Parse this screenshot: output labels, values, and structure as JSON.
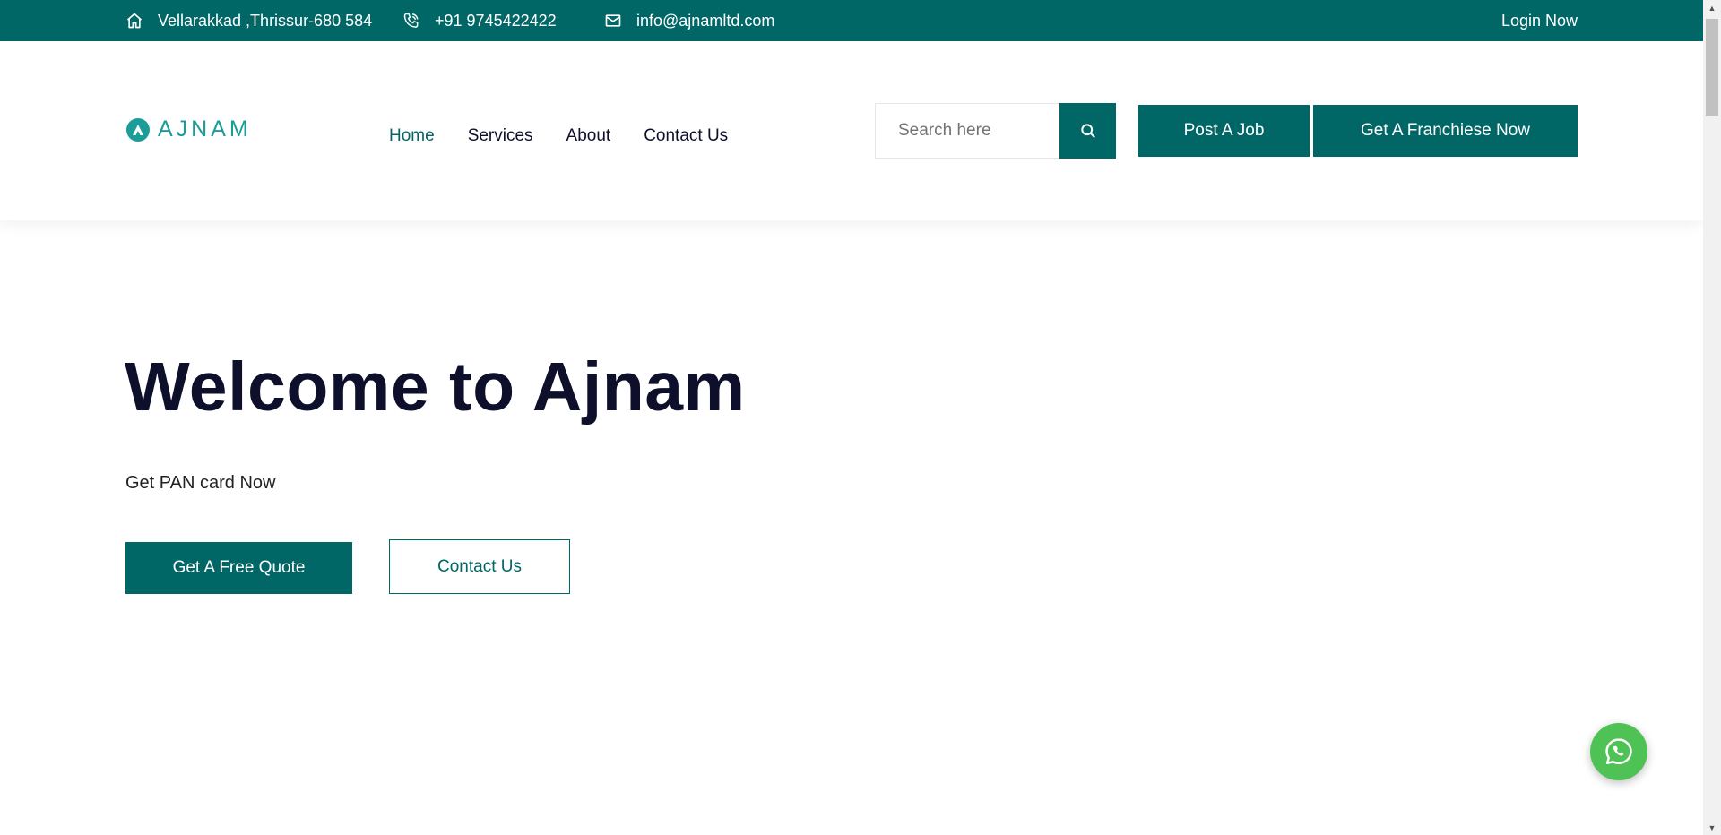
{
  "topbar": {
    "address": "Vellarakkad ,Thrissur-680 584",
    "phone": "+91 9745422422",
    "email": "info@ajnamltd.com",
    "login": "Login Now",
    "icons": {
      "address": "home-icon",
      "phone": "phone-icon",
      "email": "mail-icon"
    }
  },
  "header": {
    "logo_text": "AJNAM",
    "nav": [
      "Home",
      "Services",
      "About",
      "Contact Us"
    ],
    "active_nav": "Home",
    "search_placeholder": "Search here",
    "post_job": "Post A Job",
    "franchise": "Get A Franchiese Now"
  },
  "hero": {
    "title": "Welcome to Ajnam",
    "subtitle": "Get PAN card Now",
    "primary_button": "Get A Free Quote",
    "secondary_button": "Contact Us"
  },
  "colors": {
    "brand": "#016766",
    "logo": "#1a9d98",
    "heading": "#0d0f2b",
    "whatsapp": "#4ec254"
  },
  "floating": {
    "icon": "whatsapp-icon"
  }
}
